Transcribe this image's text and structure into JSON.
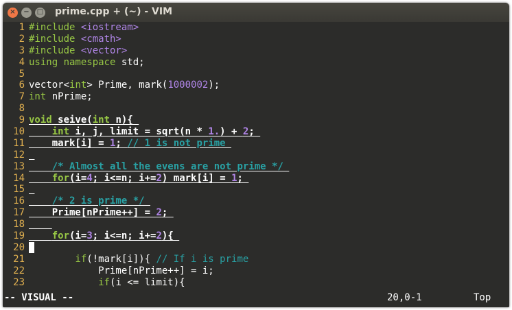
{
  "window": {
    "title": "prime.cpp + (~) - VIM",
    "buttons": {
      "close": "×",
      "minimize": "−",
      "maximize": "□"
    }
  },
  "lines": [
    {
      "n": "1",
      "segments": [
        {
          "t": "#include ",
          "c": "kw"
        },
        {
          "t": "<iostream>",
          "c": "str"
        }
      ]
    },
    {
      "n": "2",
      "segments": [
        {
          "t": "#include ",
          "c": "kw"
        },
        {
          "t": "<cmath>",
          "c": "str"
        }
      ]
    },
    {
      "n": "3",
      "segments": [
        {
          "t": "#include ",
          "c": "kw"
        },
        {
          "t": "<vector>",
          "c": "str"
        }
      ]
    },
    {
      "n": "4",
      "segments": [
        {
          "t": "using ",
          "c": "kw"
        },
        {
          "t": "namespace ",
          "c": "kw"
        },
        {
          "t": "std;",
          "c": ""
        }
      ]
    },
    {
      "n": "5",
      "segments": []
    },
    {
      "n": "6",
      "segments": [
        {
          "t": "vector<",
          "c": ""
        },
        {
          "t": "int",
          "c": "kw"
        },
        {
          "t": "> Prime, mark(",
          "c": ""
        },
        {
          "t": "1000002",
          "c": "num"
        },
        {
          "t": ");",
          "c": ""
        }
      ]
    },
    {
      "n": "7",
      "segments": [
        {
          "t": "int",
          "c": "kw"
        },
        {
          "t": " nPrime;",
          "c": ""
        }
      ]
    },
    {
      "n": "8",
      "segments": []
    },
    {
      "n": "9",
      "sel": true,
      "segments": [
        {
          "t": "void",
          "c": "kw"
        },
        {
          "t": " seive(",
          "c": ""
        },
        {
          "t": "int",
          "c": "kw"
        },
        {
          "t": " n){ ",
          "c": ""
        }
      ]
    },
    {
      "n": "10",
      "sel": true,
      "segments": [
        {
          "t": "    ",
          "c": ""
        },
        {
          "t": "int",
          "c": "kw"
        },
        {
          "t": " i, j, limit = sqrt(n * ",
          "c": ""
        },
        {
          "t": "1.",
          "c": "num"
        },
        {
          "t": ") + ",
          "c": ""
        },
        {
          "t": "2",
          "c": "num"
        },
        {
          "t": "; ",
          "c": ""
        }
      ]
    },
    {
      "n": "11",
      "sel": true,
      "segments": [
        {
          "t": "    mark[i] = ",
          "c": ""
        },
        {
          "t": "1",
          "c": "num"
        },
        {
          "t": "; ",
          "c": ""
        },
        {
          "t": "// 1 is not prime ",
          "c": "cmt"
        }
      ]
    },
    {
      "n": "12",
      "sel": true,
      "segments": [
        {
          "t": " ",
          "c": ""
        }
      ]
    },
    {
      "n": "13",
      "sel": true,
      "segments": [
        {
          "t": "    ",
          "c": ""
        },
        {
          "t": "/* Almost all the evens are not prime */ ",
          "c": "cmt"
        }
      ]
    },
    {
      "n": "14",
      "sel": true,
      "segments": [
        {
          "t": "    ",
          "c": ""
        },
        {
          "t": "for",
          "c": "kw"
        },
        {
          "t": "(i=",
          "c": ""
        },
        {
          "t": "4",
          "c": "num"
        },
        {
          "t": "; i<=n; i+=",
          "c": ""
        },
        {
          "t": "2",
          "c": "num"
        },
        {
          "t": ") mark[i] = ",
          "c": ""
        },
        {
          "t": "1",
          "c": "num"
        },
        {
          "t": "; ",
          "c": ""
        }
      ]
    },
    {
      "n": "15",
      "sel": true,
      "segments": [
        {
          "t": " ",
          "c": ""
        }
      ]
    },
    {
      "n": "16",
      "sel": true,
      "segments": [
        {
          "t": "    ",
          "c": ""
        },
        {
          "t": "/* 2 is prime */ ",
          "c": "cmt"
        }
      ]
    },
    {
      "n": "17",
      "sel": true,
      "segments": [
        {
          "t": "    Prime[nPrime++] = ",
          "c": ""
        },
        {
          "t": "2",
          "c": "num"
        },
        {
          "t": "; ",
          "c": ""
        }
      ]
    },
    {
      "n": "18",
      "sel": true,
      "segments": [
        {
          "t": "    ",
          "c": ""
        }
      ]
    },
    {
      "n": "19",
      "sel": true,
      "segments": [
        {
          "t": "    ",
          "c": ""
        },
        {
          "t": "for",
          "c": "kw"
        },
        {
          "t": "(i=",
          "c": ""
        },
        {
          "t": "3",
          "c": "num"
        },
        {
          "t": "; i<=n; i+=",
          "c": ""
        },
        {
          "t": "2",
          "c": "num"
        },
        {
          "t": "){ ",
          "c": ""
        }
      ]
    },
    {
      "n": "20",
      "cursor": true,
      "segments": []
    },
    {
      "n": "21",
      "segments": [
        {
          "t": "        ",
          "c": ""
        },
        {
          "t": "if",
          "c": "kw"
        },
        {
          "t": "(!mark[i]){ ",
          "c": ""
        },
        {
          "t": "// If i is prime",
          "c": "cmt"
        }
      ]
    },
    {
      "n": "22",
      "segments": [
        {
          "t": "            Prime[nPrime++] = i;",
          "c": ""
        }
      ]
    },
    {
      "n": "23",
      "segments": [
        {
          "t": "            ",
          "c": ""
        },
        {
          "t": "if",
          "c": "kw"
        },
        {
          "t": "(i <= limit){",
          "c": ""
        }
      ]
    }
  ],
  "status": {
    "mode": "-- VISUAL --",
    "position": "20,0-1",
    "scroll": "Top"
  },
  "colors": {
    "background": "#2c2c2a",
    "line_number": "#e0b050",
    "keyword": "#98c845",
    "number": "#b186e8",
    "comment": "#29a1a4",
    "close_button": "#f07746"
  }
}
